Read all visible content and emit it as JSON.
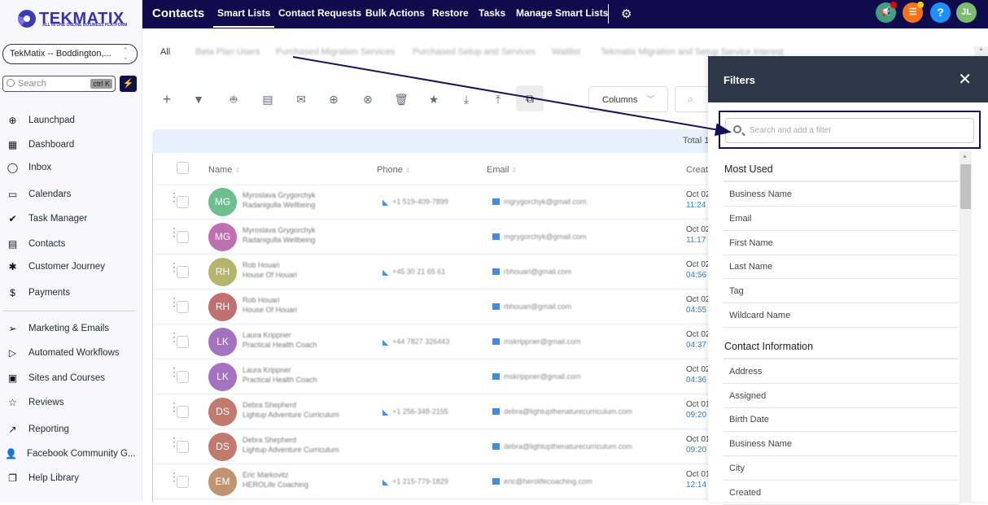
{
  "app": {
    "logo_text": "TEKMATIX",
    "logo_sub": "ALL IN ONE ONLINE BUSINESS PLATFORM",
    "account": "TekMatix -- Boddington,...",
    "search_placeholder": "Search",
    "search_shortcut": "ctrl K"
  },
  "sidebar": {
    "group1": [
      {
        "label": "Launchpad",
        "icon": "launchpad-icon"
      },
      {
        "label": "Dashboard",
        "icon": "dashboard-icon"
      },
      {
        "label": "Inbox",
        "icon": "inbox-icon"
      },
      {
        "label": "Calendars",
        "icon": "calendar-icon"
      },
      {
        "label": "Task Manager",
        "icon": "task-check-icon"
      },
      {
        "label": "Contacts",
        "icon": "contacts-icon"
      },
      {
        "label": "Customer Journey",
        "icon": "journey-icon"
      },
      {
        "label": "Payments",
        "icon": "payments-icon"
      }
    ],
    "group2": [
      {
        "label": "Marketing & Emails",
        "icon": "send-icon"
      },
      {
        "label": "Automated Workflows",
        "icon": "workflow-icon"
      },
      {
        "label": "Sites and Courses",
        "icon": "sites-icon"
      },
      {
        "label": "Reviews",
        "icon": "star-icon"
      },
      {
        "label": "Reporting",
        "icon": "trend-icon"
      },
      {
        "label": "Facebook Community G...",
        "icon": "add-user-icon"
      },
      {
        "label": "Help Library",
        "icon": "library-icon"
      }
    ]
  },
  "topbar": {
    "title": "Contacts",
    "tabs": [
      "Smart Lists",
      "Contact Requests",
      "Bulk Actions",
      "Restore",
      "Tasks",
      "Manage Smart Lists"
    ],
    "active_tab": "Smart Lists",
    "user_initials": "JL",
    "help_label": "?"
  },
  "smart_lists": [
    "All",
    "Beta Plan Users",
    "Purchased Migration Services",
    "Purchased Setup and Services",
    "Waitlist",
    "Tekmatix Migration and Setup Service Interest"
  ],
  "toolbar": {
    "icons": [
      "add-icon",
      "filter-icon",
      "robot-icon",
      "message-icon",
      "email-icon",
      "add-tag-icon",
      "remove-tag-icon",
      "delete-icon",
      "star-icon",
      "import-icon",
      "export-icon",
      "smart-list-icon"
    ],
    "columns_label": "Columns"
  },
  "table": {
    "total_label": "Total 1",
    "headers": {
      "name": "Name",
      "phone": "Phone",
      "email": "Email",
      "created": "Create"
    },
    "rows": [
      {
        "initials": "MG",
        "color": "#6dbf8f",
        "name": "Myroslava Grygorchyk",
        "company": "Radanigulla Wellbeing",
        "phone": "+1 519-409-7899",
        "email": "mgrygorchyk@gmail.com",
        "date": "Oct 02",
        "time": "11:24"
      },
      {
        "initials": "MG",
        "color": "#c06fb0",
        "name": "Myroslava Grygorchyk",
        "company": "Radanigulla Wellbeing",
        "phone": "",
        "email": "mgrygorchyk@gmail.com",
        "date": "Oct 02",
        "time": "11:17"
      },
      {
        "initials": "RH",
        "color": "#b5b56e",
        "name": "Rob Houari",
        "company": "House Of Houari",
        "phone": "+45 30 21 65 61",
        "email": "rbhouari@gmail.com",
        "date": "Oct 02",
        "time": "04:56"
      },
      {
        "initials": "RH",
        "color": "#c0706e",
        "name": "Rob Houari",
        "company": "House Of Houari",
        "phone": "",
        "email": "rbhouari@gmail.com",
        "date": "Oct 02",
        "time": "04:55"
      },
      {
        "initials": "LK",
        "color": "#a572c0",
        "name": "Laura Krippner",
        "company": "Practical Health Coach",
        "phone": "+44 7827 326443",
        "email": "mskrippner@gmail.com",
        "date": "Oct 02",
        "time": "04:37"
      },
      {
        "initials": "LK",
        "color": "#a572c0",
        "name": "Laura Krippner",
        "company": "Practical Health Coach",
        "phone": "",
        "email": "mskrippner@gmail.com",
        "date": "Oct 02",
        "time": "04:36"
      },
      {
        "initials": "DS",
        "color": "#c07a6e",
        "name": "Debra Shepherd",
        "company": "Lightup Adventure Curriculum",
        "phone": "+1 256-348-2155",
        "email": "debra@lightupthenaturecurriculum.com",
        "date": "Oct 01",
        "time": "09:20"
      },
      {
        "initials": "DS",
        "color": "#c07a6e",
        "name": "Debra Shepherd",
        "company": "Lightup Adventure Curriculum",
        "phone": "",
        "email": "debra@lightupthenaturecurriculum.com",
        "date": "Oct 01",
        "time": "09:20"
      },
      {
        "initials": "EM",
        "color": "#c09470",
        "name": "Eric Markovitz",
        "company": "HEROLife Coaching",
        "phone": "+1 215-779-1829",
        "email": "eric@herolifecoaching.com",
        "date": "Oct 01",
        "time": "12:14"
      }
    ]
  },
  "filters": {
    "title": "Filters",
    "search_placeholder": "Search and add a filter",
    "sections": [
      {
        "title": "Most Used",
        "items": [
          "Business Name",
          "Email",
          "First Name",
          "Last Name",
          "Tag",
          "Wildcard Name"
        ]
      },
      {
        "title": "Contact Information",
        "items": [
          "Address",
          "Assigned",
          "Birth Date",
          "Business Name",
          "City",
          "Created"
        ]
      }
    ]
  }
}
